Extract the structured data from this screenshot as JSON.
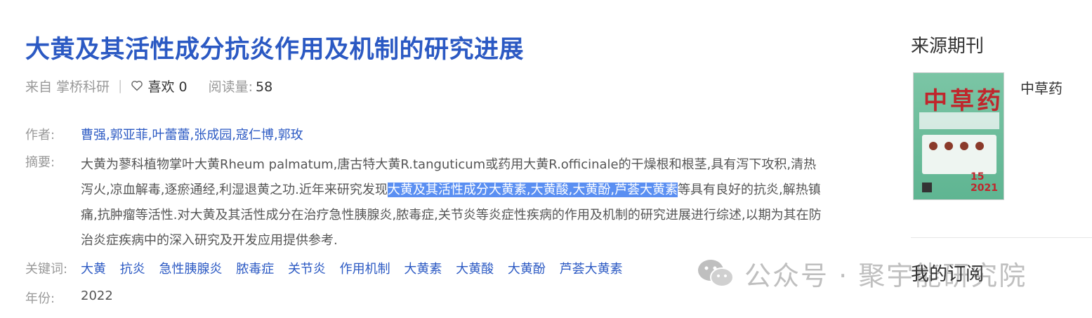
{
  "article": {
    "title": "大黄及其活性成分抗炎作用及机制的研究进展",
    "meta": {
      "source": "来自 掌桥科研",
      "separator": "|",
      "like_label": "喜欢 0",
      "read_label": "阅读量:",
      "read_count": "58"
    },
    "authors_label": "作者:",
    "authors": [
      "曹强",
      "郭亚菲",
      "叶蕾蕾",
      "张成园",
      "寇仁博",
      "郭玫"
    ],
    "author_sep": ",",
    "abstract_label": "摘要:",
    "abstract_before": "大黄为蓼科植物掌叶大黄Rheum palmatum,唐古特大黄R.tanguticum或药用大黄R.officinale的干燥根和根茎,具有泻下攻积,清热泻火,凉血解毒,逐瘀通经,利湿退黄之功.近年来研究发现",
    "abstract_highlight": "大黄及其活性成分大黄素,大黄酸,大黄酚,芦荟大黄素",
    "abstract_after": "等具有良好的抗炎,解热镇痛,抗肿瘤等活性.对大黄及其活性成分在治疗急性胰腺炎,脓毒症,关节炎等炎症性疾病的作用及机制的研究进展进行综述,以期为其在防治炎症疾病中的深入研究及开发应用提供参考.",
    "keywords_label": "关键词:",
    "keywords": [
      "大黄",
      "抗炎",
      "急性胰腺炎",
      "脓毒症",
      "关节炎",
      "作用机制",
      "大黄素",
      "大黄酸",
      "大黄酚",
      "芦荟大黄素"
    ],
    "year_label": "年份:",
    "year": "2022"
  },
  "sidebar": {
    "source_title": "来源期刊",
    "journal_name": "中草药",
    "cover": {
      "title_text": "中草药",
      "issue": "15",
      "year": "2021"
    },
    "subscription_title": "我的订阅"
  },
  "watermark": {
    "text": "公众号 · 聚宇能研究院"
  },
  "colors": {
    "title_blue": "#2b59c3",
    "link_blue": "#2b59c3",
    "highlight": "#5a8ff2",
    "label_gray": "#999999"
  }
}
